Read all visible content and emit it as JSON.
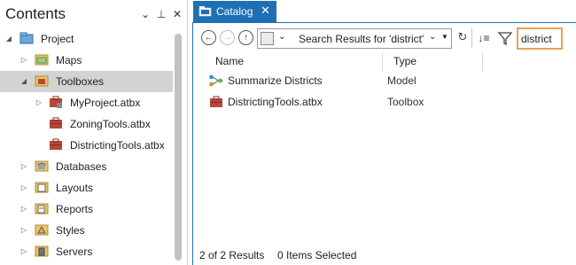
{
  "contents": {
    "title": "Contents",
    "header_buttons": {
      "options": "⌄",
      "pin": "⊥",
      "close": "✕"
    },
    "tree": {
      "project": "Project",
      "maps": "Maps",
      "toolboxes": "Toolboxes",
      "toolbox_children": [
        "MyProject.atbx",
        "ZoningTools.atbx",
        "DistrictingTools.atbx"
      ],
      "databases": "Databases",
      "layouts": "Layouts",
      "reports": "Reports",
      "styles": "Styles",
      "servers": "Servers"
    }
  },
  "catalog": {
    "tab_label": "Catalog",
    "location_text": "Search Results for 'district'",
    "search_value": "district",
    "columns": {
      "name": "Name",
      "type": "Type"
    },
    "rows": [
      {
        "name": "Summarize Districts",
        "type": "Model",
        "icon": "model-icon"
      },
      {
        "name": "DistrictingTools.atbx",
        "type": "Toolbox",
        "icon": "toolbox-icon"
      }
    ],
    "status": {
      "count": "2 of 2 Results",
      "selected": "0 Items Selected"
    }
  },
  "colors": {
    "accent_blue": "#1f6fb5",
    "selection_gray": "#d3d3d3",
    "search_border_orange": "#e8a15a",
    "toolbox_red": "#b5483a",
    "folder_yellow": "#e9c46a"
  }
}
